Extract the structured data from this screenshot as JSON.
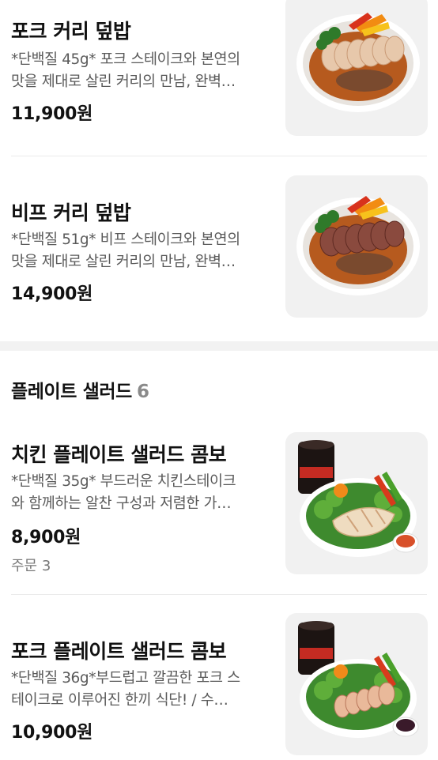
{
  "sections": [
    {
      "items": [
        {
          "name": "포크 커리 덮밥",
          "desc_line1": "*단백질 45g* 포크 스테이크와 본연의",
          "desc_line2": "맛을 제대로 살린 커리의 만남, 완벽…",
          "price": "11,900원",
          "image_icon": "pork-curry-bowl-photo"
        },
        {
          "name": "비프 커리 덮밥",
          "desc_line1": "*단백질 51g* 비프 스테이크와 본연의",
          "desc_line2": "맛을 제대로 살린 커리의 만남, 완벽…",
          "price": "14,900원",
          "image_icon": "beef-curry-bowl-photo"
        }
      ]
    },
    {
      "title": "플레이트 샐러드",
      "count": "6",
      "items": [
        {
          "name": "치킨 플레이트 샐러드 콤보",
          "desc_line1": "*단백질 35g* 부드러운 치킨스테이크",
          "desc_line2": "와 함께하는 알찬 구성과 저렴한 가…",
          "price": "8,900원",
          "orders": "주문 3",
          "image_icon": "chicken-salad-combo-photo"
        },
        {
          "name": "포크 플레이트 샐러드 콤보",
          "desc_line1": "*단백질 36g*부드럽고 깔끔한 포크 스",
          "desc_line2": "테이크로 이루어진 한끼 식단! / 수…",
          "price": "10,900원",
          "image_icon": "pork-salad-combo-photo"
        }
      ]
    }
  ],
  "colors": {
    "text_primary": "#111111",
    "text_secondary": "#5a5a5a",
    "count_gray": "#8a8a8a",
    "thumb_bg": "#f1f1f1",
    "section_gap": "#f2f2f2"
  }
}
